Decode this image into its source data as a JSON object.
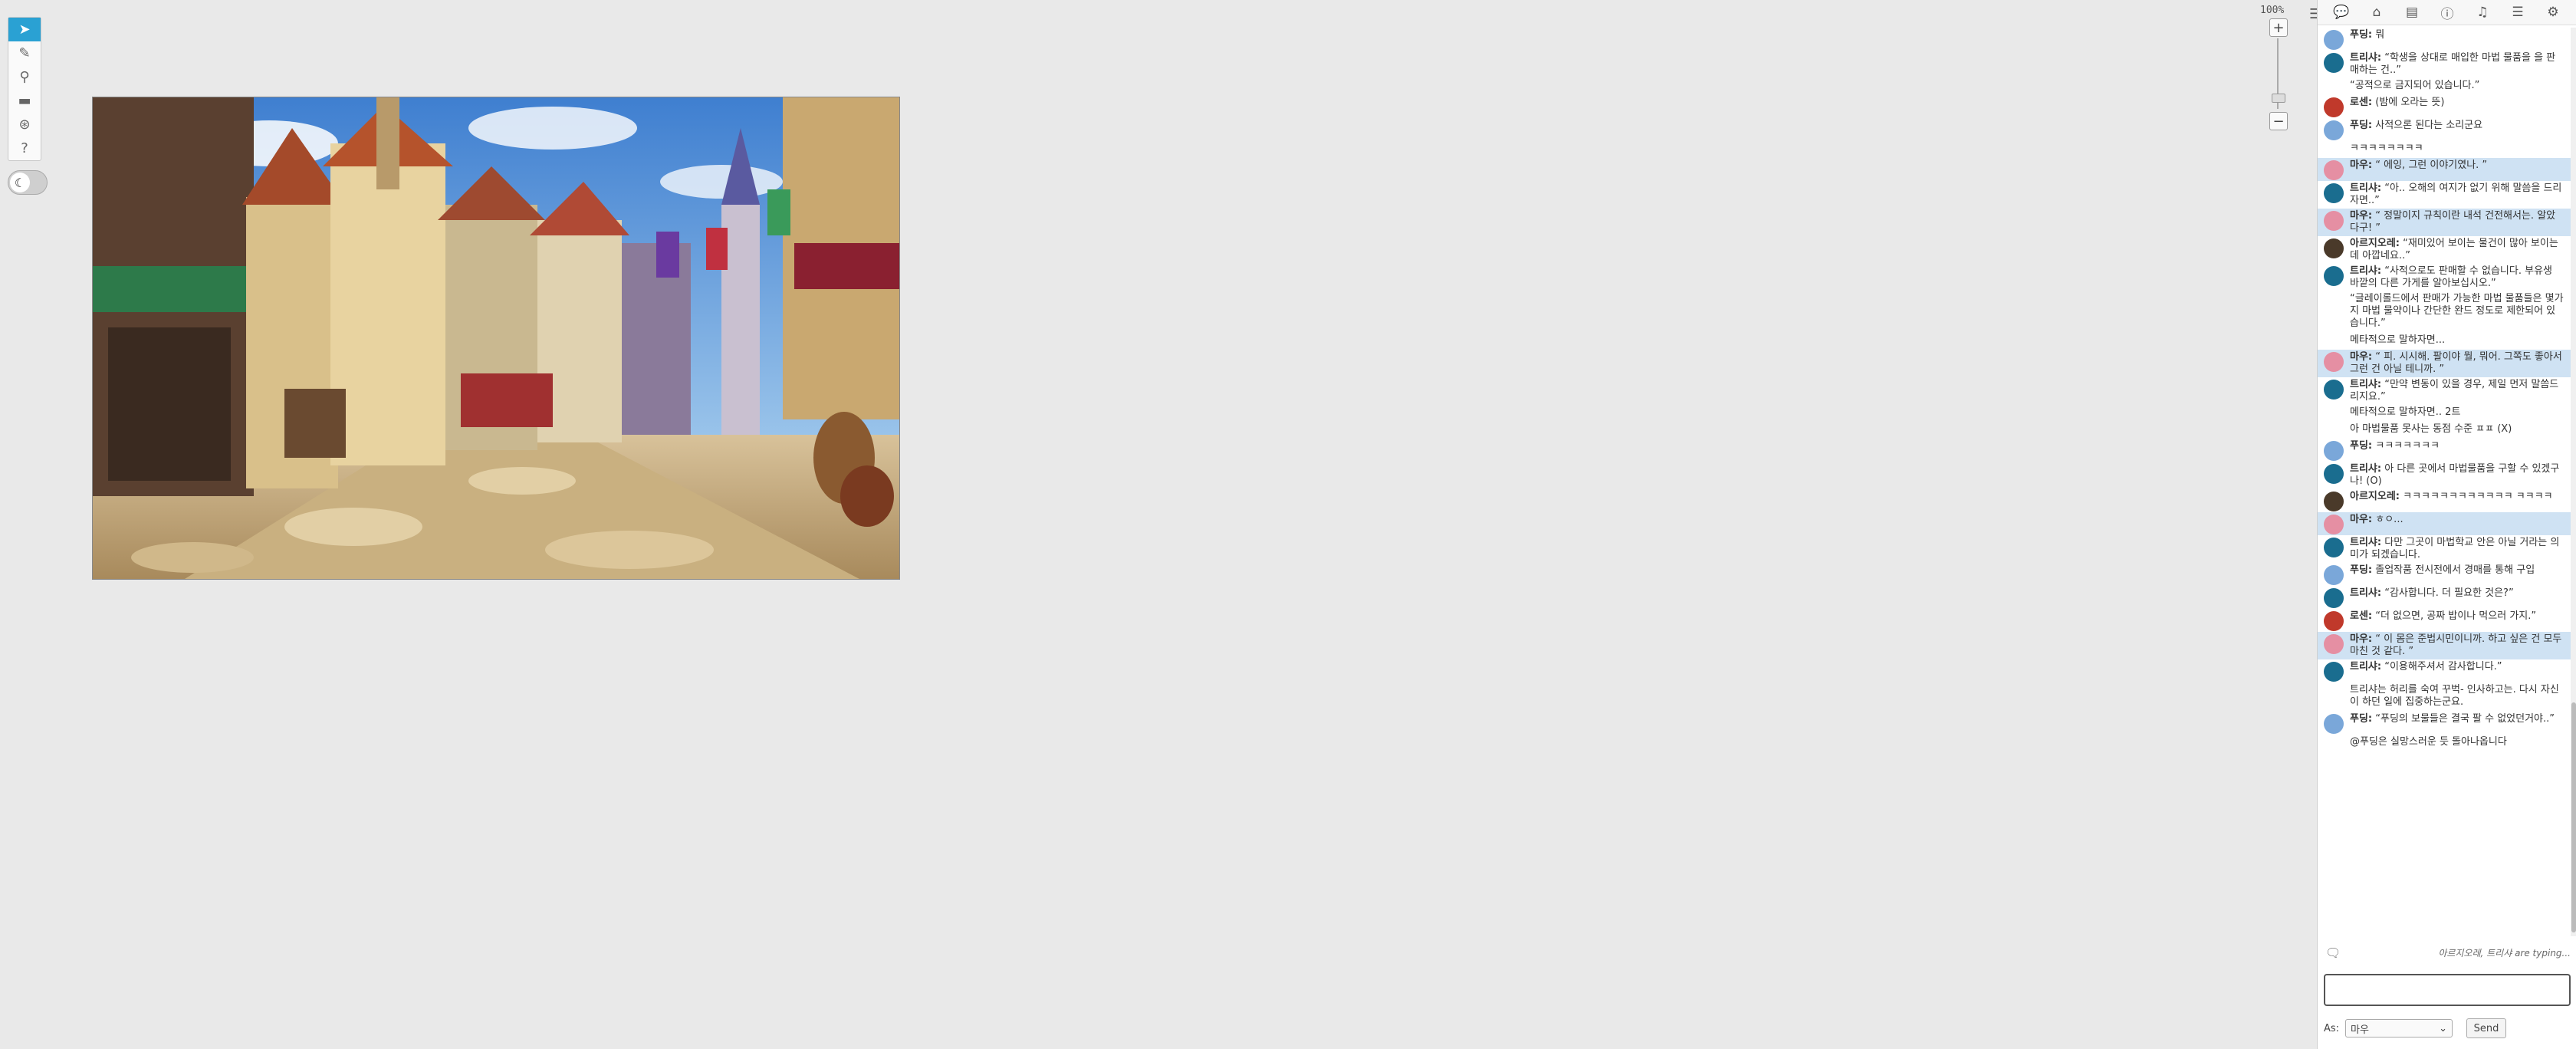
{
  "canvas": {
    "zoom_label": "100%",
    "zoom_plus": "+",
    "zoom_minus": "−"
  },
  "toolbar": [
    {
      "name": "select-tool",
      "icon": "➤",
      "active": true
    },
    {
      "name": "draw-tool",
      "icon": "✎",
      "active": false
    },
    {
      "name": "zoom-tool",
      "icon": "⚲",
      "active": false
    },
    {
      "name": "measure-tool",
      "icon": "▬",
      "active": false
    },
    {
      "name": "roll-tool",
      "icon": "⊛",
      "active": false
    },
    {
      "name": "help-tool",
      "icon": "?",
      "active": false
    }
  ],
  "dark_toggle": {
    "icon": "☾"
  },
  "sidebar": {
    "tabs": [
      {
        "name": "chat-tab",
        "icon": "💬"
      },
      {
        "name": "art-tab",
        "icon": "⌂"
      },
      {
        "name": "journal-tab",
        "icon": "▤"
      },
      {
        "name": "info-tab",
        "icon": "ⓘ"
      },
      {
        "name": "jukebox-tab",
        "icon": "♫"
      },
      {
        "name": "list-tab",
        "icon": "☰"
      },
      {
        "name": "settings-tab",
        "icon": "⚙"
      }
    ],
    "messages": [
      {
        "who": "푸딩:",
        "text": "뭐",
        "av": "#7aa7d9",
        "hl": false
      },
      {
        "who": "트리샤:",
        "text": "“학생을 상대로 매입한 마법 물품을 을 판매하는 건..”",
        "av": "#1a6d8f",
        "hl": false,
        "sub": "“공적으로 금지되어 있습니다.”"
      },
      {
        "who": "로센:",
        "text": "(밤에 오라는 뜻)",
        "av": "#c0392b",
        "hl": false
      },
      {
        "who": "푸딩:",
        "text": "사적으론 된다는 소리군요",
        "av": "#7aa7d9",
        "hl": false,
        "sub": "ㅋㅋㅋㅋㅋㅋㅋㅋ"
      },
      {
        "who": "마우:",
        "text": "“ 에잉, 그런 이야기였나. ”",
        "av": "#e58fa3",
        "hl": true
      },
      {
        "who": "트리샤:",
        "text": "“아.. 오해의 여지가 없기 위해 말씀을 드리자면..”",
        "av": "#1a6d8f",
        "hl": false
      },
      {
        "who": "마우:",
        "text": "“ 정말이지 규칙이란 내석 건전해서는. 알았다구! ”",
        "av": "#e58fa3",
        "hl": true
      },
      {
        "who": "아르지오레:",
        "text": "“재미있어 보이는 물건이 많아 보이는데 아깝네요..”",
        "av": "#4a3a2a",
        "hl": false
      },
      {
        "who": "트리샤:",
        "text": "“사적으로도 판매할 수 없습니다. 부유생 바깥의 다른 가게를 알아보십시오.”",
        "av": "#1a6d8f",
        "hl": false,
        "sub": "“글레이롤드에서 판매가 가능한 마법 물품들은 몇가지 마법 물약이나 간단한 완드 정도로 제한되어 있습니다.”",
        "sub2": "메타적으로 말하자면..."
      },
      {
        "who": "마우:",
        "text": "“ 피. 시시해. 팔이야 뭘, 뭐어. 그쪽도 좋아서 그런 건 아닐 테니까. ”",
        "av": "#e58fa3",
        "hl": true
      },
      {
        "who": "트리샤:",
        "text": "“만약 변동이 있을 경우, 제일 먼저 말씀드리지요.”",
        "av": "#1a6d8f",
        "hl": false,
        "sub": "메타적으로 말하자면.. 2트",
        "sub2": "아 마법물품 못사는 동점 수준 ㅍㅍ (X)"
      },
      {
        "who": "푸딩:",
        "text": "ㅋㅋㅋㅋㅋㅋㅋ",
        "av": "#7aa7d9",
        "hl": false
      },
      {
        "who": "트리샤:",
        "text": "아 다른 곳에서 마법물품을 구할 수 있겠구나! (O)",
        "av": "#1a6d8f",
        "hl": false
      },
      {
        "who": "아르지오레:",
        "text": "ㅋㅋㅋㅋㅋㅋㅋㅋㅋㅋㅋㅋ ㅋㅋㅋㅋ",
        "av": "#4a3a2a",
        "hl": false
      },
      {
        "who": "마우:",
        "text": "ㅎㅇ...",
        "av": "#e58fa3",
        "hl": true
      },
      {
        "who": "트리샤:",
        "text": "다만 그곳이 마법학교 안은 아닐 거라는 의미가 되겠습니다.",
        "av": "#1a6d8f",
        "hl": false
      },
      {
        "who": "푸딩:",
        "text": "졸업작품 전시전에서 경매를 통해 구입",
        "av": "#7aa7d9",
        "hl": false
      },
      {
        "who": "트리샤:",
        "text": "“감사합니다. 더 필요한 것은?”",
        "av": "#1a6d8f",
        "hl": false
      },
      {
        "who": "로센:",
        "text": "“더 없으면, 공짜 밥이나 먹으러 가지.”",
        "av": "#c0392b",
        "hl": false
      },
      {
        "who": "마우:",
        "text": "“ 이 몸은 준법시민이니까. 하고 싶은 건 모두 마친 것 같다. ”",
        "av": "#e58fa3",
        "hl": true
      },
      {
        "who": "트리샤:",
        "text": "“이용해주셔서 감사합니다.”",
        "av": "#1a6d8f",
        "hl": false,
        "sub": "트리샤는 허리를 숙여 꾸벅- 인사하고는. 다시 자신이 하던 일에 집중하는군요."
      },
      {
        "who": "푸딩:",
        "text": "“푸딩의 보물들은 결국 팔 수 없었던거야..”",
        "av": "#7aa7d9",
        "hl": false,
        "sub": "@푸딩은 실망스러운 듯 돌아나옵니다"
      }
    ],
    "typing_text": "아르지오레, 트리샤 are typing...",
    "as_label": "As:",
    "as_value": "마우",
    "send_label": "Send"
  }
}
